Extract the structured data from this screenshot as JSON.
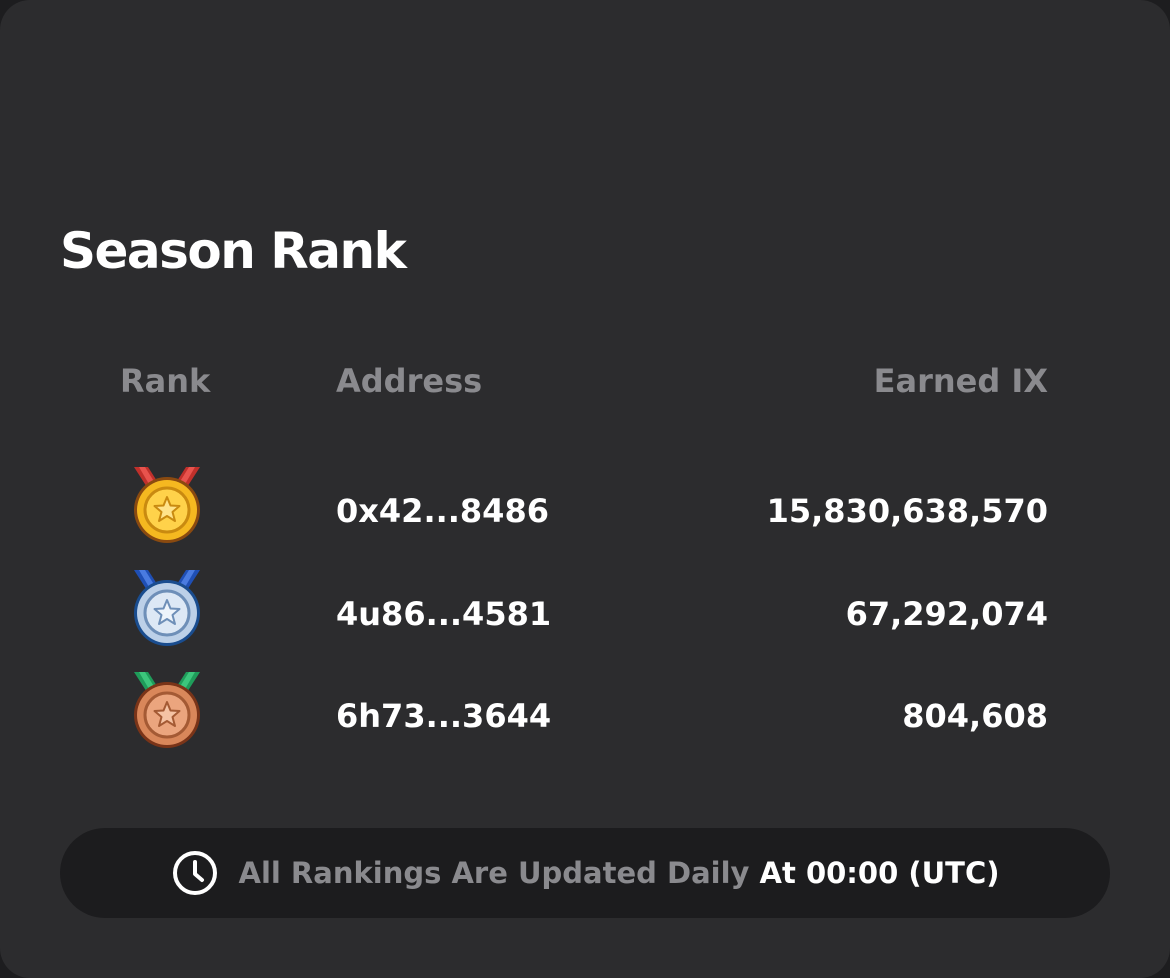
{
  "title": "Season Rank",
  "columns": {
    "rank": "Rank",
    "address": "Address",
    "earned": "Earned IX"
  },
  "rows": [
    {
      "medal": "gold-medal-icon",
      "address": "0x42...8486",
      "earned": "15,830,638,570"
    },
    {
      "medal": "silver-medal-icon",
      "address": "4u86...4581",
      "earned": "67,292,074"
    },
    {
      "medal": "bronze-medal-icon",
      "address": "6h73...3644",
      "earned": "804,608"
    }
  ],
  "footer": {
    "icon": "clock-icon",
    "text_muted": "All Rankings Are Updated Daily",
    "text_strong": "At 00:00 (UTC)"
  },
  "colors": {
    "card": "#2c2c2e",
    "footer_bg": "#1c1c1e",
    "muted_text": "#8a8a8e",
    "gold": "#f5b820",
    "silver": "#bcd0e8",
    "bronze": "#d9875a"
  }
}
